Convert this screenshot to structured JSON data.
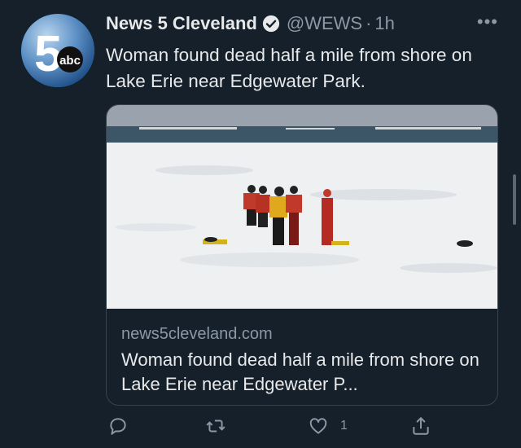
{
  "tweet": {
    "avatar_icon": "abc-5-logo",
    "avatar_text": {
      "big": "5",
      "small": "abc"
    },
    "display_name": "News 5 Cleveland",
    "verified_icon": "verified-badge-icon",
    "handle": "@WEWS",
    "separator": "·",
    "time": "1h",
    "more_icon": "more-options-icon",
    "text": "Woman found dead half a mile from shore on Lake Erie near Edgewater Park."
  },
  "card": {
    "image": "photo of rescuers standing on frozen ice of Lake Erie",
    "domain": "news5cleveland.com",
    "title": "Woman found dead half a mile from shore on Lake Erie near Edgewater P..."
  },
  "actions": {
    "reply_icon": "reply-icon",
    "retweet_icon": "retweet-icon",
    "like_icon": "heart-icon",
    "like_count": "1",
    "share_icon": "share-icon"
  },
  "colors": {
    "background": "#15202b",
    "text": "#e7e9ea",
    "muted": "#8b98a5",
    "border": "#38444d"
  }
}
